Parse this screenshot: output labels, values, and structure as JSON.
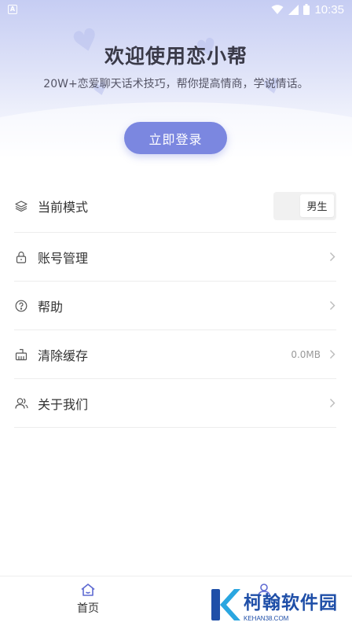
{
  "status_bar": {
    "time": "10:35"
  },
  "header": {
    "title": "欢迎使用恋小帮",
    "subtitle": "20W+恋爱聊天话术技巧，帮你提高情商，学说情话。",
    "login_label": "立即登录"
  },
  "menu": {
    "mode": {
      "label": "当前模式",
      "toggle_value": "男生"
    },
    "account": {
      "label": "账号管理"
    },
    "help": {
      "label": "帮助"
    },
    "cache": {
      "label": "清除缓存",
      "value": "0.0MB"
    },
    "about": {
      "label": "关于我们"
    }
  },
  "tabbar": {
    "home_label": "首页"
  },
  "watermark": {
    "title": "柯翰软件园",
    "subtitle": "KEHAN38.COM"
  },
  "colors": {
    "accent": "#7b87e0",
    "hero_top": "#c6cdf3",
    "watermark": "#1f4fa8"
  }
}
